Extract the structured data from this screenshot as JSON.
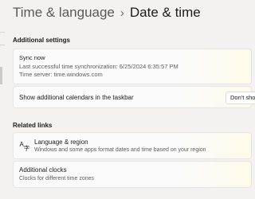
{
  "header": {
    "breadcrumb_parent": "Time & language",
    "breadcrumb_separator": "›",
    "breadcrumb_current": "Date & time"
  },
  "additional_settings": {
    "heading": "Additional settings",
    "sync": {
      "button_label": "Sync now",
      "last_sync": "Last successful time synchronization: 6/25/2024 6:35:57 PM",
      "time_server": "Time server: time.windows.com"
    },
    "calendars": {
      "label": "Show additional calendars in the taskbar",
      "selected_value": "Don't show"
    }
  },
  "related_links": {
    "heading": "Related links",
    "items": [
      {
        "title": "Language & region",
        "subtitle": "Windows and some apps format dates and time based on your region",
        "icon": "language-region-icon"
      },
      {
        "title": "Additional clocks",
        "subtitle": "Clocks for different time zones"
      }
    ]
  }
}
